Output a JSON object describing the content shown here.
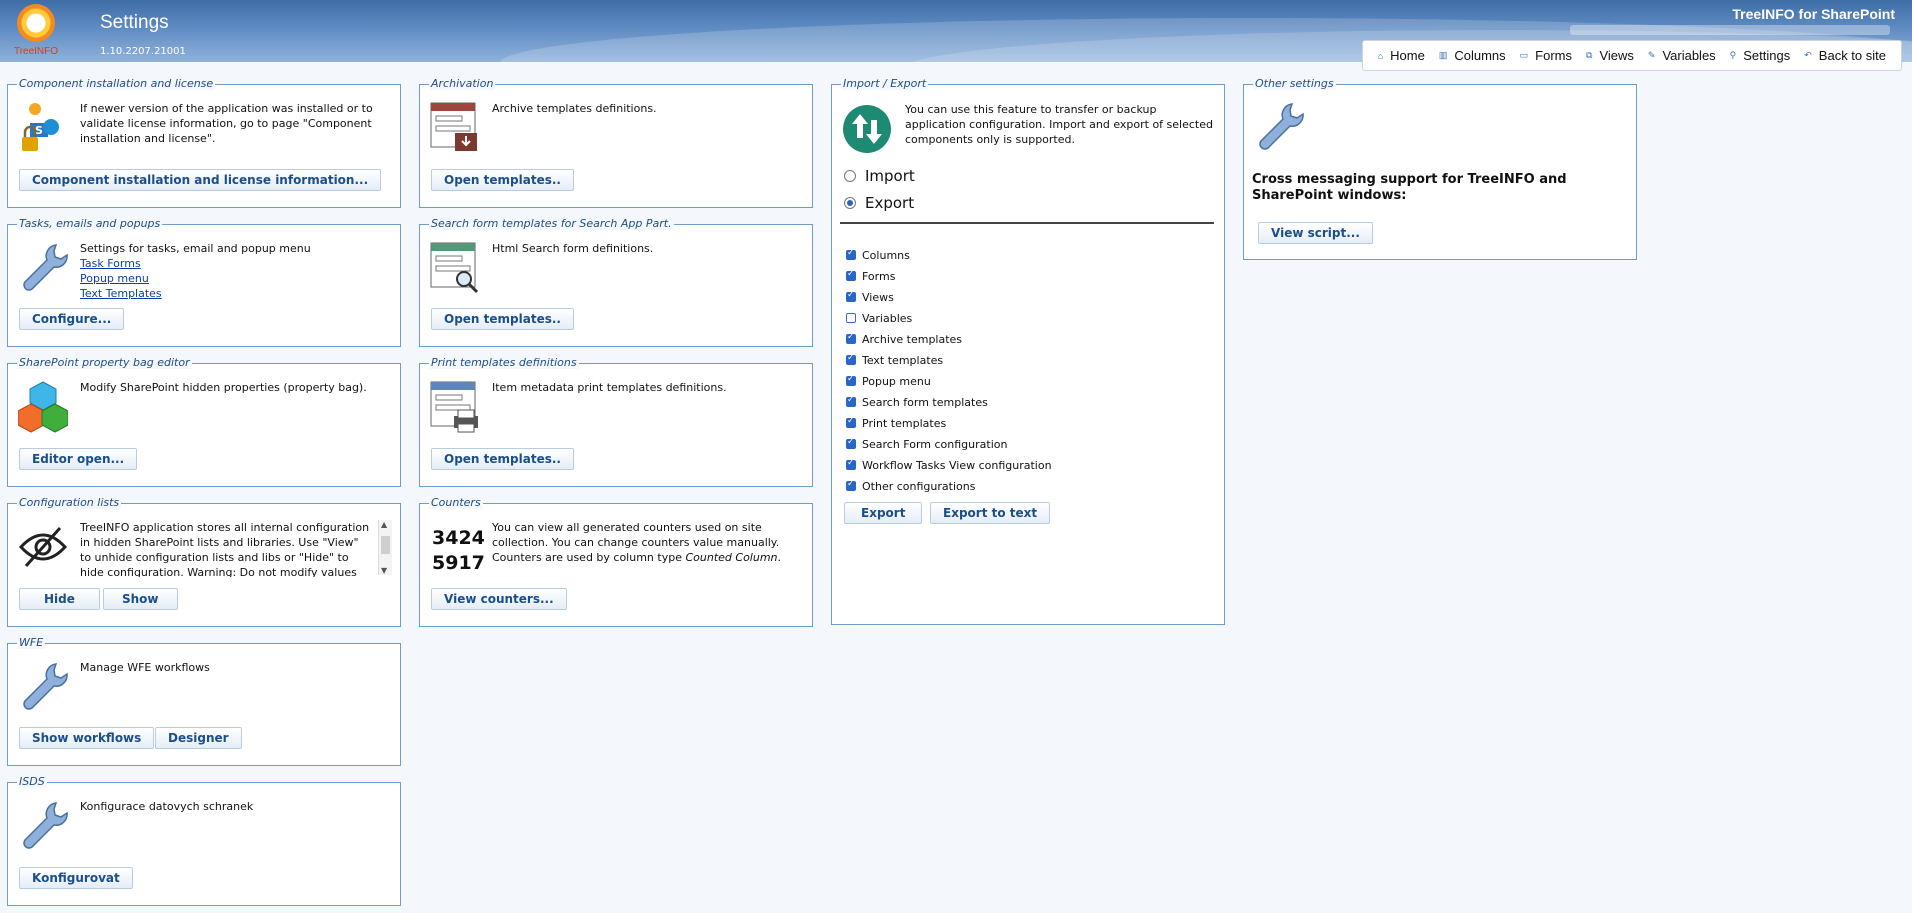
{
  "header": {
    "logo_text": "TreeINFO",
    "page_title": "Settings",
    "version": "1.10.2207.21001",
    "product": "TreeINFO for SharePoint",
    "nav": [
      {
        "label": "Home",
        "icon": "home-icon"
      },
      {
        "label": "Columns",
        "icon": "columns-icon"
      },
      {
        "label": "Forms",
        "icon": "forms-icon"
      },
      {
        "label": "Views",
        "icon": "views-icon"
      },
      {
        "label": "Variables",
        "icon": "variables-icon"
      },
      {
        "label": "Settings",
        "icon": "settings-icon"
      },
      {
        "label": "Back to site",
        "icon": "back-icon"
      }
    ]
  },
  "component": {
    "legend": "Component installation and license",
    "text": "If newer version of the application was installed or to validate license information, go to page \"Component installation and license\".",
    "button": "Component installation and license information..."
  },
  "tasks": {
    "legend": "Tasks, emails and popups",
    "text": "Settings for tasks, email and popup menu",
    "links": [
      "Task Forms",
      "Popup menu",
      "Text Templates"
    ],
    "button": "Configure..."
  },
  "propertybag": {
    "legend": "SharePoint property bag editor",
    "text": "Modify SharePoint hidden properties (property bag).",
    "button": "Editor open..."
  },
  "configlists": {
    "legend": "Configuration lists",
    "text": "TreeINFO application stores all internal configuration in hidden SharePoint lists and libraries. Use \"View\" to unhide configuration lists and libs or \"Hide\" to hide configuration. Warning: Do not modify values directly in",
    "hide_button": "Hide",
    "show_button": "Show"
  },
  "wfe": {
    "legend": "WFE",
    "text": "Manage WFE workflows",
    "show_button": "Show workflows",
    "designer_button": "Designer"
  },
  "isds": {
    "legend": "ISDS",
    "text": "Konfigurace datovych schranek",
    "button": "Konfigurovat"
  },
  "archivation": {
    "legend": "Archivation",
    "text": "Archive templates definitions.",
    "button": "Open templates.."
  },
  "searchforms": {
    "legend": "Search form templates for Search App Part.",
    "text": "Html Search form definitions.",
    "button": "Open templates.."
  },
  "printtemplates": {
    "legend": "Print templates definitions",
    "text": "Item metadata print templates definitions.",
    "button": "Open templates.."
  },
  "counters": {
    "legend": "Counters",
    "digits_top": "3424",
    "digits_bottom": "5917",
    "text_a": "You can view all generated counters used on site collection. You can change counters value manually. Counters are used by column type",
    "text_em": "Counted Column",
    "text_b": ".",
    "button": "View counters..."
  },
  "importexport": {
    "legend": "Import / Export",
    "text": "You can use this feature to transfer or backup application configuration. Import and export of selected components only is supported.",
    "import_label": "Import",
    "export_label": "Export",
    "mode": "export",
    "options": [
      {
        "label": "Columns",
        "checked": true
      },
      {
        "label": "Forms",
        "checked": true
      },
      {
        "label": "Views",
        "checked": true
      },
      {
        "label": "Variables",
        "checked": false
      },
      {
        "label": "Archive templates",
        "checked": true
      },
      {
        "label": "Text templates",
        "checked": true
      },
      {
        "label": "Popup menu",
        "checked": true
      },
      {
        "label": "Search form templates",
        "checked": true
      },
      {
        "label": "Print templates",
        "checked": true
      },
      {
        "label": "Search Form configuration",
        "checked": true
      },
      {
        "label": "Workflow Tasks View configuration",
        "checked": true
      },
      {
        "label": "Other configurations",
        "checked": true
      }
    ],
    "export_button": "Export",
    "export_text_button": "Export to text"
  },
  "other": {
    "legend": "Other settings",
    "text": "Cross messaging support for TreeINFO and SharePoint windows:",
    "button": "View script..."
  },
  "colors": {
    "header_blue": "#4f7db5",
    "panel_border": "#6f9cc9",
    "legend_text": "#1f4d85",
    "button_text": "#1b4f8c",
    "link": "#0b3fa7"
  }
}
